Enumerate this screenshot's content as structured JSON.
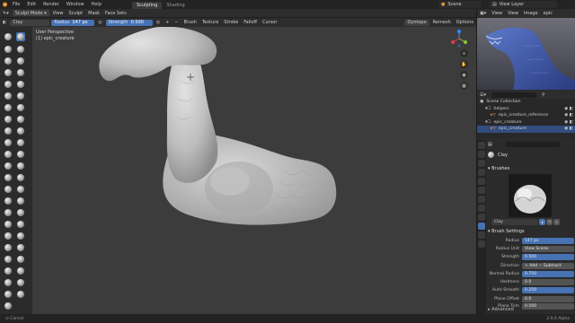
{
  "menubar": {
    "items": [
      "File",
      "Edit",
      "Render",
      "Window",
      "Help"
    ],
    "workspace_tabs": [
      {
        "label": "Sculpting",
        "active": true
      },
      {
        "label": "Shading",
        "active": false
      }
    ],
    "scene": "Scene",
    "view_layer": "View Layer"
  },
  "header": {
    "mode": "Sculpt Mode",
    "menus": [
      "View",
      "Sculpt",
      "Mask",
      "Face Sets"
    ],
    "brush_name": "Clay",
    "radius_label": "Radius",
    "radius_value": "147 px",
    "strength_label": "Strength",
    "strength_value": "0.500",
    "dropdowns": [
      "Brush",
      "Texture",
      "Stroke",
      "Falloff",
      "Cursor"
    ],
    "dyntopo": "Dyntopo",
    "remesh": "Remesh",
    "options": "Options"
  },
  "viewport": {
    "perspective": "User Perspective",
    "object": "(1) epic_creature"
  },
  "image_editor": {
    "menus": [
      "View",
      "View",
      "Image"
    ],
    "title": "epic"
  },
  "outliner": {
    "rows": [
      {
        "label": "Scene Collection",
        "indent": 0,
        "selected": false
      },
      {
        "label": "helpers",
        "indent": 1,
        "selected": false
      },
      {
        "label": "epic_creature_reference",
        "indent": 2,
        "selected": false
      },
      {
        "label": "epic_creature",
        "indent": 1,
        "selected": false
      },
      {
        "label": "epic_creature",
        "indent": 2,
        "selected": true
      }
    ]
  },
  "properties": {
    "brush_name": "Clay",
    "brushes_section": "Brushes",
    "brush_field": "Clay",
    "brush_settings_section": "Brush Settings",
    "rows": [
      {
        "label": "Radius",
        "value": "147 px",
        "blue": true
      },
      {
        "label": "Radius Unit",
        "value": "View   Scene",
        "blue": false
      },
      {
        "label": "Strength",
        "value": "0.500",
        "blue": true
      },
      {
        "label": "Direction",
        "value": "+ Add     − Subtract",
        "blue": false
      },
      {
        "label": "Normal Radius",
        "value": "0.750",
        "blue": true
      },
      {
        "label": "Hardness",
        "value": "0.0",
        "blue": false
      },
      {
        "label": "Auto-Smooth",
        "value": "0.250",
        "blue": true
      },
      {
        "label": "Plane Offset",
        "value": "0.0",
        "blue": false
      },
      {
        "label": "Plane Trim",
        "value": "0.500",
        "blue": false
      }
    ],
    "advanced_section": "Advanced"
  },
  "status": {
    "left": "Cancel",
    "right": "2.9.0 Alpha"
  },
  "colors": {
    "accent": "#4772b3",
    "viewport_bg": "#3c3c3c",
    "mesh": "#c9c9c9"
  }
}
